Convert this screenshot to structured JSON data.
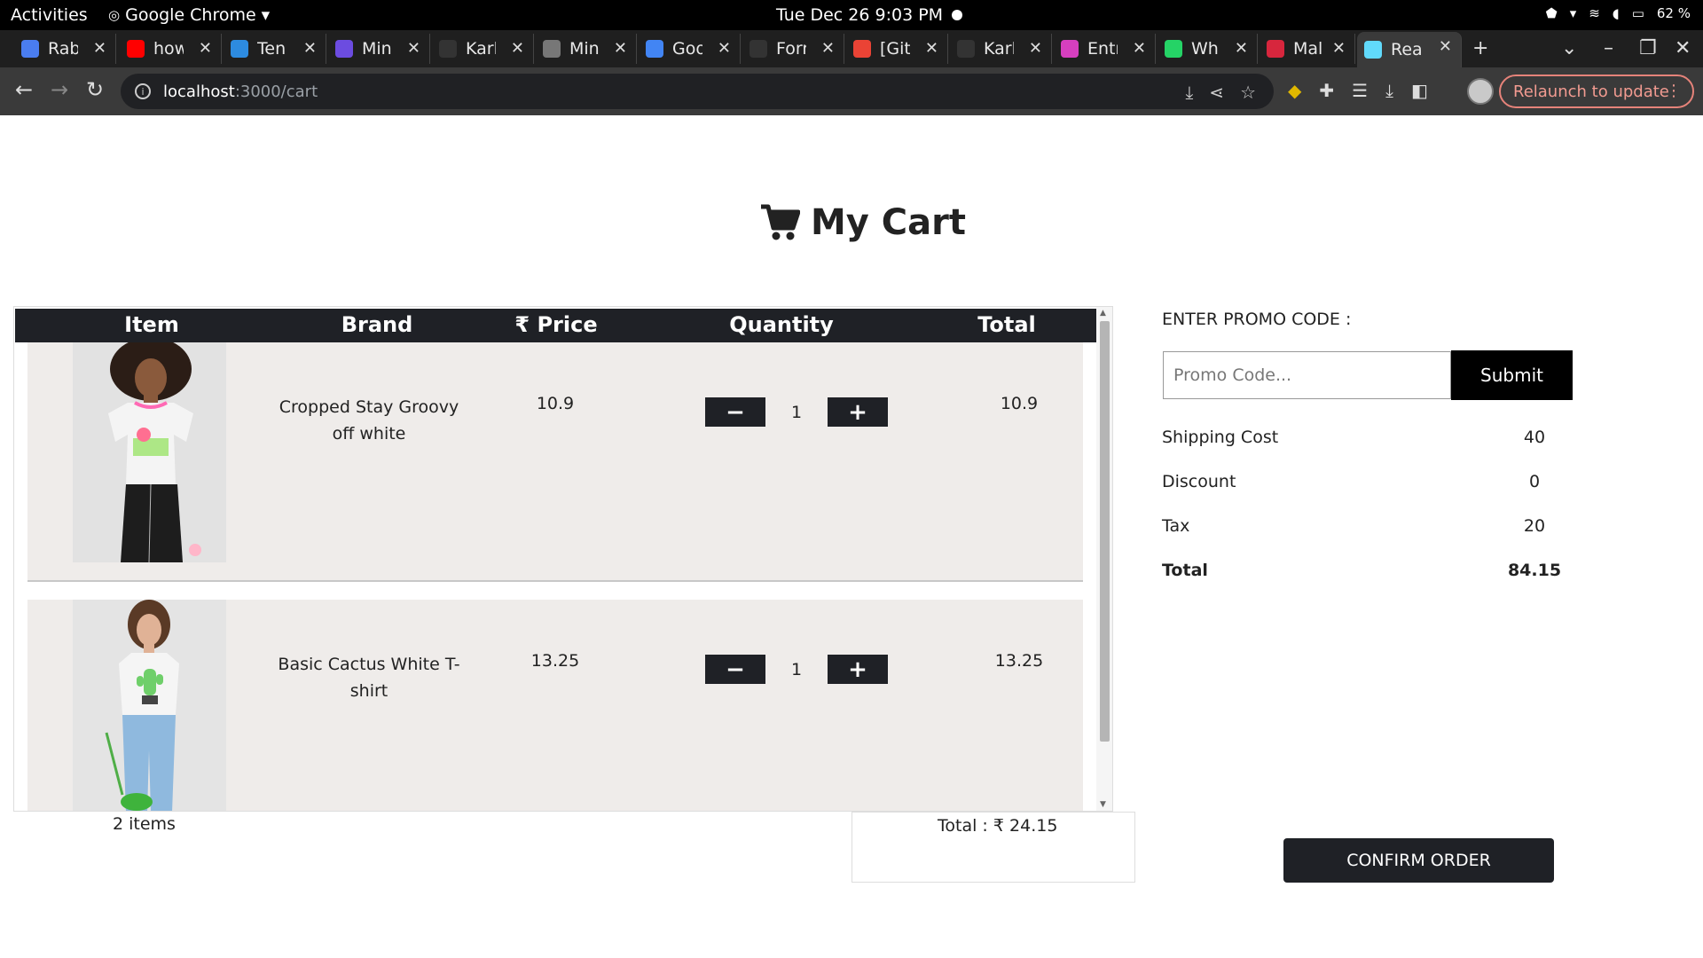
{
  "system_bar": {
    "activities": "Activities",
    "app_name": "Google Chrome",
    "clock": "Tue Dec 26  9:03 PM",
    "battery": "62 %"
  },
  "tabs": [
    {
      "title": "Rab",
      "icon": "docs-icon",
      "color": "#4a7df0"
    },
    {
      "title": "how",
      "icon": "youtube-icon",
      "color": "#ff0000"
    },
    {
      "title": "Ten",
      "icon": "canva-icon",
      "color": "#2d8be0"
    },
    {
      "title": "Min",
      "icon": "app-icon",
      "color": "#6c4ce0"
    },
    {
      "title": "Karl",
      "icon": "github-icon",
      "color": "#333333"
    },
    {
      "title": "Min",
      "icon": "globe-icon",
      "color": "#777777"
    },
    {
      "title": "Goo",
      "icon": "google-icon",
      "color": "#4285f4"
    },
    {
      "title": "Forr",
      "icon": "github-icon",
      "color": "#333333"
    },
    {
      "title": "[Git",
      "icon": "gmail-icon",
      "color": "#ea4335"
    },
    {
      "title": "Karl",
      "icon": "github-icon",
      "color": "#333333"
    },
    {
      "title": "Entr",
      "icon": "app-icon",
      "color": "#d63fbf"
    },
    {
      "title": "Wh",
      "icon": "whatsapp-icon",
      "color": "#25d366"
    },
    {
      "title": "Mal",
      "icon": "myntra-icon",
      "color": "#d7263d"
    },
    {
      "title": "Rea",
      "icon": "react-icon",
      "color": "#61dafb",
      "active": true
    }
  ],
  "address_bar": {
    "host": "localhost",
    "path": ":3000/cart"
  },
  "relaunch_label": "Relaunch to update",
  "page": {
    "title": "My Cart",
    "columns": {
      "item": "Item",
      "brand": "Brand",
      "price": "Price",
      "quantity": "Quantity",
      "total": "Total"
    },
    "rows": [
      {
        "name": "Cropped Stay Groovy off white",
        "price": "10.9",
        "qty": "1",
        "total": "10.9"
      },
      {
        "name": "Basic Cactus White T-shirt",
        "price": "13.25",
        "qty": "1",
        "total": "13.25"
      }
    ],
    "item_count": "2 items",
    "cart_total_label": "Total :",
    "cart_total_value": "24.15",
    "promo": {
      "label": "ENTER PROMO CODE :",
      "placeholder": "Promo Code...",
      "submit": "Submit"
    },
    "summary": [
      {
        "label": "Shipping Cost",
        "value": "40"
      },
      {
        "label": "Discount",
        "value": "0"
      },
      {
        "label": "Tax",
        "value": "20"
      },
      {
        "label": "Total",
        "value": "84.15"
      }
    ],
    "confirm": "CONFIRM ORDER"
  }
}
